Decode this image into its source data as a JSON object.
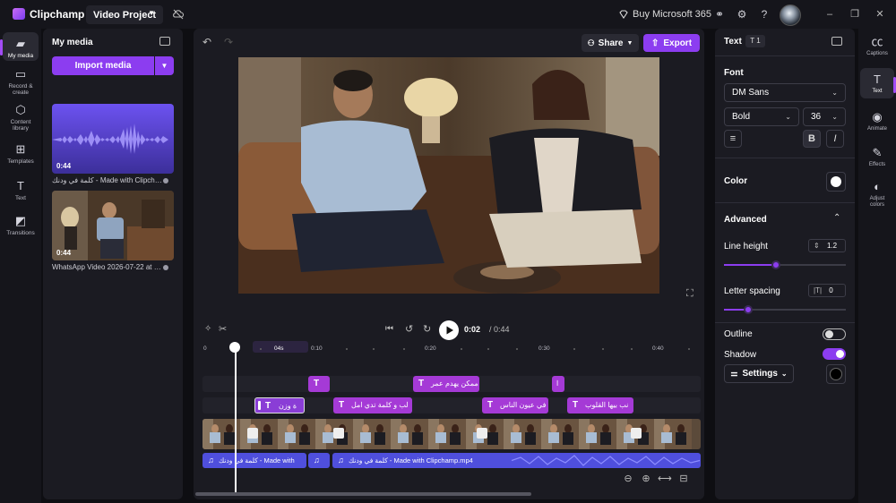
{
  "topbar": {
    "app_name": "Clipchamp",
    "project_name": "Video Project",
    "buy_label": "Buy Microsoft 365"
  },
  "left_rail": [
    {
      "label": "My media",
      "icon": "folder-icon"
    },
    {
      "label": "Record & create",
      "icon": "camera-icon"
    },
    {
      "label": "Content library",
      "icon": "library-icon"
    },
    {
      "label": "Templates",
      "icon": "templates-icon"
    },
    {
      "label": "Text",
      "icon": "text-icon"
    },
    {
      "label": "Transitions",
      "icon": "transitions-icon"
    }
  ],
  "media": {
    "title": "My media",
    "import_label": "Import media",
    "items": [
      {
        "duration": "0:44",
        "caption": "كلمة في ودنك - Made with Clipcha..."
      },
      {
        "duration": "0:44",
        "caption": "WhatsApp Video 2026-07-22 at 01..."
      }
    ]
  },
  "preview": {
    "share_label": "Share",
    "export_label": "Export",
    "time_current": "0:02",
    "time_total": "/ 0:44"
  },
  "timeline": {
    "ruler": [
      "0",
      "04s",
      "0:10",
      "0:20",
      "0:30",
      "0:40"
    ],
    "text_row1": [
      {
        "label": ""
      },
      {
        "label": "ممكن يهدم عمر"
      },
      {
        "label": "ا"
      }
    ],
    "text_row2": [
      {
        "label": "ة وزن"
      },
      {
        "label": "لب و كلمة تدي امل"
      },
      {
        "label": "في عيون الناس"
      },
      {
        "label": "نب بيها القلوب"
      }
    ],
    "audio": [
      {
        "label": "كلمة في ودنك - Made with"
      },
      {
        "label": ""
      },
      {
        "label": "كلمة في ودنك - Made with Clipchamp.mp4"
      }
    ]
  },
  "props": {
    "tab_label": "Text",
    "tab_count": "1",
    "font_heading": "Font",
    "font_family": "DM Sans",
    "font_weight": "Bold",
    "font_size": "36",
    "color_label": "Color",
    "color_value": "#ffffff",
    "advanced_label": "Advanced",
    "line_height_label": "Line height",
    "line_height_value": "1.2",
    "line_height_level": 0.43,
    "letter_spacing_label": "Letter spacing",
    "letter_spacing_value": "0",
    "letter_spacing_level": 0.2,
    "outline_label": "Outline",
    "outline_on": false,
    "shadow_label": "Shadow",
    "shadow_on": true,
    "settings_label": "Settings"
  },
  "right_rail": [
    {
      "label": "Captions",
      "icon": "captions-icon"
    },
    {
      "label": "Text",
      "icon": "text-icon"
    },
    {
      "label": "Animate",
      "icon": "animate-icon"
    },
    {
      "label": "Effects",
      "icon": "effects-icon"
    },
    {
      "label": "Adjust colors",
      "icon": "adjust-colors-icon"
    }
  ],
  "colors": {
    "accent": "#8c3df0",
    "text_clip": "#a53ad6",
    "audio_clip": "#4f4fdd"
  }
}
